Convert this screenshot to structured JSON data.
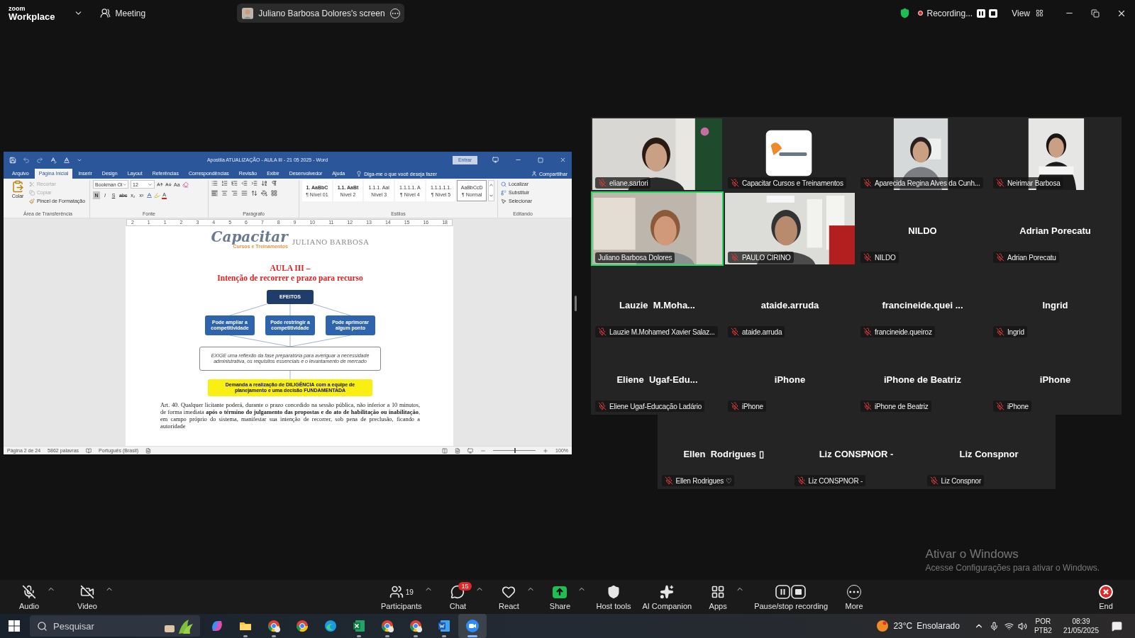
{
  "zoom_bar": {
    "logo_top": "zoom",
    "logo_bottom": "Workplace",
    "meeting_label": "Meeting",
    "share_label": "Juliano Barbosa Dolores's screen",
    "recording_label": "Recording...",
    "view_label": "View"
  },
  "word": {
    "title": "Apostila ATUALIZAÇÃO - AULA III - 21 05 2025  -  Word",
    "sign_in": "Entrar",
    "tabs": [
      {
        "label": "Arquivo",
        "selected": false
      },
      {
        "label": "Página Inicial",
        "selected": true
      },
      {
        "label": "Inserir",
        "selected": false
      },
      {
        "label": "Design",
        "selected": false
      },
      {
        "label": "Layout",
        "selected": false
      },
      {
        "label": "Referências",
        "selected": false
      },
      {
        "label": "Correspondências",
        "selected": false
      },
      {
        "label": "Revisão",
        "selected": false
      },
      {
        "label": "Exibir",
        "selected": false
      },
      {
        "label": "Desenvolvedor",
        "selected": false
      },
      {
        "label": "Ajuda",
        "selected": false
      }
    ],
    "tell_me": "Diga-me o que você deseja fazer",
    "share": "Compartilhar",
    "clipboard": {
      "group": "Área de Transferência",
      "paste": "Colar",
      "actions": [
        {
          "label": "Recortar",
          "disabled": true
        },
        {
          "label": "Copiar",
          "disabled": true
        },
        {
          "label": "Pincel de Formatação",
          "disabled": false
        }
      ]
    },
    "font": {
      "group": "Fonte",
      "name": "Bookman Ol",
      "size": "12",
      "case_button": "Aa",
      "color_button": "A",
      "buttons": [
        {
          "label": "N",
          "selected": true
        },
        {
          "label": "I",
          "selected": false
        },
        {
          "label": "S",
          "selected": false
        },
        {
          "label": "abc",
          "selected": false
        },
        {
          "label": "x₂",
          "selected": false
        },
        {
          "label": "x²",
          "selected": false
        }
      ]
    },
    "paragraph": {
      "group": "Parágrafo"
    },
    "styles": {
      "group": "Estilos",
      "items": [
        {
          "sample": "1.  AaBbC",
          "name": "¶ Nível 01",
          "selected": false
        },
        {
          "sample": "1.1.  AaBt",
          "name": "Nível 2",
          "selected": false
        },
        {
          "sample": "1.1.1.  Aal",
          "name": "Nível 3",
          "selected": false
        },
        {
          "sample": "1.1.1.1.  A",
          "name": "¶ Nível 4",
          "selected": false
        },
        {
          "sample": "1.1.1.1.1.",
          "name": "¶ Nível 5",
          "selected": false
        },
        {
          "sample": "AaBbCcD",
          "name": "¶ Normal",
          "selected": true
        }
      ]
    },
    "editing": {
      "group": "Editando",
      "items": [
        "Localizar",
        "Substituir",
        "Selecionar"
      ]
    },
    "ruler_labels": [
      "2",
      "1",
      "1",
      "2",
      "3",
      "4",
      "5",
      "6",
      "7",
      "8",
      "9",
      "10",
      "11",
      "12",
      "13",
      "14",
      "15",
      "16",
      "18"
    ],
    "document": {
      "logo_main": "Capacitar",
      "logo_sub": "Cursos e Treinamentos",
      "logo_second": "JULIANO BARBOSA",
      "heading": "AULA III –",
      "subheading": "Intenção de recorrer e prazo para recurso",
      "diagram": {
        "root": "EFEITOS",
        "branches": [
          "Pode ampliar a competitividade",
          "Pode restringir a competitividade",
          "Pode aprimorar algum ponto"
        ],
        "requirement": "EXIGE uma reflexão da fase preparatória para averiguar a necessidade administrativa, os requisitos essenciais e o levantamento de mercado",
        "demand": "Demanda a realização de **DILIGÊNCIA** com a equipe de planejamento e uma decisão **FUNDAMENTADA**"
      },
      "body": "Art. 40. Qualquer licitante poderá, durante o prazo concedido na sessão pública, não inferior a 10 minutos, de forma imediata **após o término do julgamento das propostas e do ato de habilitação ou inabilitação**, em campo próprio do sistema, manifestar sua intenção de recorrer, sob pena de preclusão, ficando a autoridade"
    },
    "status": {
      "page": "Página 2 de 24",
      "words": "5862 palavras",
      "language": "Português (Brasil)",
      "zoom": "100%",
      "zoom_slider": {
        "level": 0.5
      }
    }
  },
  "gallery": {
    "tiles": [
      {
        "kind": "picture",
        "label": "eliane.sartori",
        "muted": true,
        "speaking": false
      },
      {
        "kind": "picture",
        "label": "Capacitar Cursos e Treinamentos",
        "muted": true,
        "speaking": false
      },
      {
        "kind": "picture",
        "label": "Aparecida Regina Alves da Cunh...",
        "muted": true,
        "speaking": false
      },
      {
        "kind": "picture",
        "label": "Neirimar Barbosa",
        "muted": true,
        "speaking": false
      },
      {
        "kind": "picture",
        "label": "Juliano Barbosa Dolores",
        "muted": false,
        "speaking": true
      },
      {
        "kind": "picture",
        "label": "PAULO CIRINO",
        "muted": true,
        "speaking": false
      },
      {
        "kind": "name",
        "name": "NILDO",
        "label": "NILDO",
        "muted": true,
        "speaking": false
      },
      {
        "kind": "name",
        "name": "Adrian Porecatu",
        "label": "Adrian Porecatu",
        "muted": true,
        "speaking": false
      },
      {
        "kind": "name",
        "name": "Lauzie  M.Moha...",
        "label": "Lauzie M.Mohamed Xavier Salaz...",
        "muted": true,
        "speaking": false
      },
      {
        "kind": "name",
        "name": "ataide.arruda",
        "label": "ataide.arruda",
        "muted": true,
        "speaking": false
      },
      {
        "kind": "name",
        "name": "francineide.quei ...",
        "label": "francineide.queiroz",
        "muted": true,
        "speaking": false
      },
      {
        "kind": "name",
        "name": "Ingrid",
        "label": "Ingrid",
        "muted": true,
        "speaking": false
      },
      {
        "kind": "name",
        "name": "Eliene  Ugaf-Edu...",
        "label": "Eliene Ugaf-Educação Ladário",
        "muted": true,
        "speaking": false
      },
      {
        "kind": "name",
        "name": "iPhone",
        "label": "iPhone",
        "muted": true,
        "speaking": false
      },
      {
        "kind": "name",
        "name": "iPhone de Beatriz",
        "label": "iPhone de Beatriz",
        "muted": true,
        "speaking": false
      },
      {
        "kind": "name",
        "name": "iPhone",
        "label": "iPhone",
        "muted": true,
        "speaking": false
      }
    ],
    "extra_tiles": [
      {
        "kind": "name",
        "name": "Ellen  Rodrigues ▯",
        "label": "Ellen Rodrigues ♡",
        "muted": true,
        "speaking": false
      },
      {
        "kind": "name",
        "name": "Liz CONSPNOR -",
        "label": "Liz CONSPNOR -",
        "muted": true,
        "speaking": false
      },
      {
        "kind": "name",
        "name": "Liz Conspnor",
        "label": "Liz Conspnor",
        "muted": true,
        "speaking": false
      }
    ]
  },
  "activation": {
    "title": "Ativar o Windows",
    "text": "Acesse Configurações para ativar o Windows."
  },
  "toolbar": {
    "left": [
      {
        "kind": "audio",
        "label": "Audio",
        "caret": true
      },
      {
        "kind": "video",
        "label": "Video",
        "caret": true
      }
    ],
    "center": [
      {
        "kind": "participants",
        "label": "Participants",
        "count": "19",
        "caret": true
      },
      {
        "kind": "chat",
        "label": "Chat",
        "badge": "15",
        "caret": true
      },
      {
        "kind": "react",
        "label": "React",
        "caret": true
      },
      {
        "kind": "share",
        "label": "Share",
        "caret": true
      },
      {
        "kind": "host",
        "label": "Host tools",
        "caret": false
      },
      {
        "kind": "ai",
        "label": "AI Companion",
        "caret": false
      },
      {
        "kind": "apps",
        "label": "Apps",
        "caret": true
      },
      {
        "kind": "record",
        "label": "Pause/stop recording",
        "caret": false
      },
      {
        "kind": "more",
        "label": "More",
        "caret": false
      }
    ],
    "end_label": "End"
  },
  "taskbar": {
    "search_placeholder": "Pesquisar",
    "apps": [
      {
        "kind": "swirl",
        "running": false,
        "selected": false
      },
      {
        "kind": "folder",
        "running": true,
        "selected": false
      },
      {
        "kind": "browser-profile",
        "running": true,
        "selected": false
      },
      {
        "kind": "browser",
        "running": false,
        "selected": false
      },
      {
        "kind": "wave",
        "running": false,
        "selected": false
      },
      {
        "kind": "spreadsheet",
        "running": true,
        "selected": false
      },
      {
        "kind": "browser-profile",
        "running": true,
        "selected": false
      },
      {
        "kind": "browser-profile",
        "running": true,
        "selected": false
      },
      {
        "kind": "document",
        "running": true,
        "selected": false
      },
      {
        "kind": "video-call",
        "running": true,
        "selected": true
      }
    ],
    "temperature": "23°C",
    "weather": "Ensolarado",
    "lang_top": "POR",
    "lang_bottom": "PTB2",
    "time": "08:39",
    "date": "21/05/2025"
  }
}
